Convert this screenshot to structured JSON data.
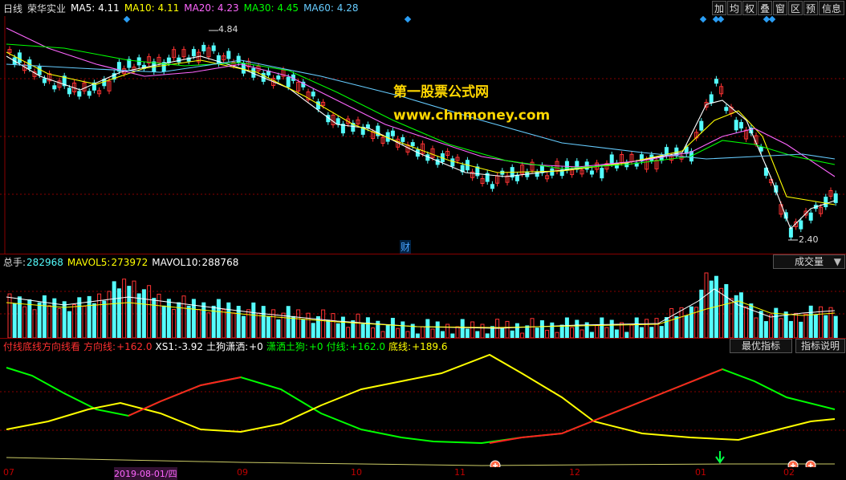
{
  "header": {
    "period": "日线",
    "stock_name": "荣华实业",
    "ma": [
      {
        "label": "MA5: 4.11",
        "color": "#ffffff"
      },
      {
        "label": "MA10: 4.11",
        "color": "#ffff00"
      },
      {
        "label": "MA20: 4.23",
        "color": "#ff66ff"
      },
      {
        "label": "MA30: 4.45",
        "color": "#00ff00"
      },
      {
        "label": "MA60: 4.28",
        "color": "#66ccff"
      }
    ]
  },
  "toolbar": [
    "加",
    "均",
    "权",
    "叠",
    "窗",
    "区",
    "预",
    "信息"
  ],
  "price_panel": {
    "high_label": "4.84",
    "low_label": "2.40",
    "finance_marker": "财",
    "watermark_title": "第一股票公式网",
    "watermark_url": "www.chnmoney.com"
  },
  "volume_panel": {
    "items": [
      {
        "label": "总手:",
        "value": "282968",
        "color": "#ffffff"
      },
      {
        "label": "MAVOL5:",
        "value": "273972",
        "color": "#ffff00"
      },
      {
        "label": "MAVOL10:",
        "value": "288768",
        "color": "#ffffff"
      }
    ],
    "dropdown_label": "成交量"
  },
  "indicator_panel": {
    "name": "付线底线方向线看",
    "items": [
      {
        "label": "方向线:",
        "value": "+162.0",
        "color": "#ff3030"
      },
      {
        "label": "XS1:",
        "value": "-3.92",
        "color": "#ffffff"
      },
      {
        "label": "土狗潇洒:",
        "value": "+0",
        "color": "#ffffff"
      },
      {
        "label": "潇洒土狗:",
        "value": "+0",
        "color": "#00ff00"
      },
      {
        "label": "付线:",
        "value": "+162.0",
        "color": "#00ff00"
      },
      {
        "label": "底线:",
        "value": "+189.6",
        "color": "#ffff00"
      }
    ],
    "buttons": [
      "最优指标",
      "指标说明"
    ]
  },
  "x_axis": {
    "ticks": [
      "07",
      "2019-08-01/四",
      "09",
      "10",
      "11",
      "12",
      "01",
      "02"
    ]
  },
  "colors": {
    "up": "#ff3333",
    "down": "#54fcfc",
    "grid": "#8a0000",
    "ma5": "#ffffff",
    "ma10": "#ffff00",
    "ma20": "#ff66ff",
    "ma30": "#00ff00",
    "ma60": "#66ccff"
  }
}
